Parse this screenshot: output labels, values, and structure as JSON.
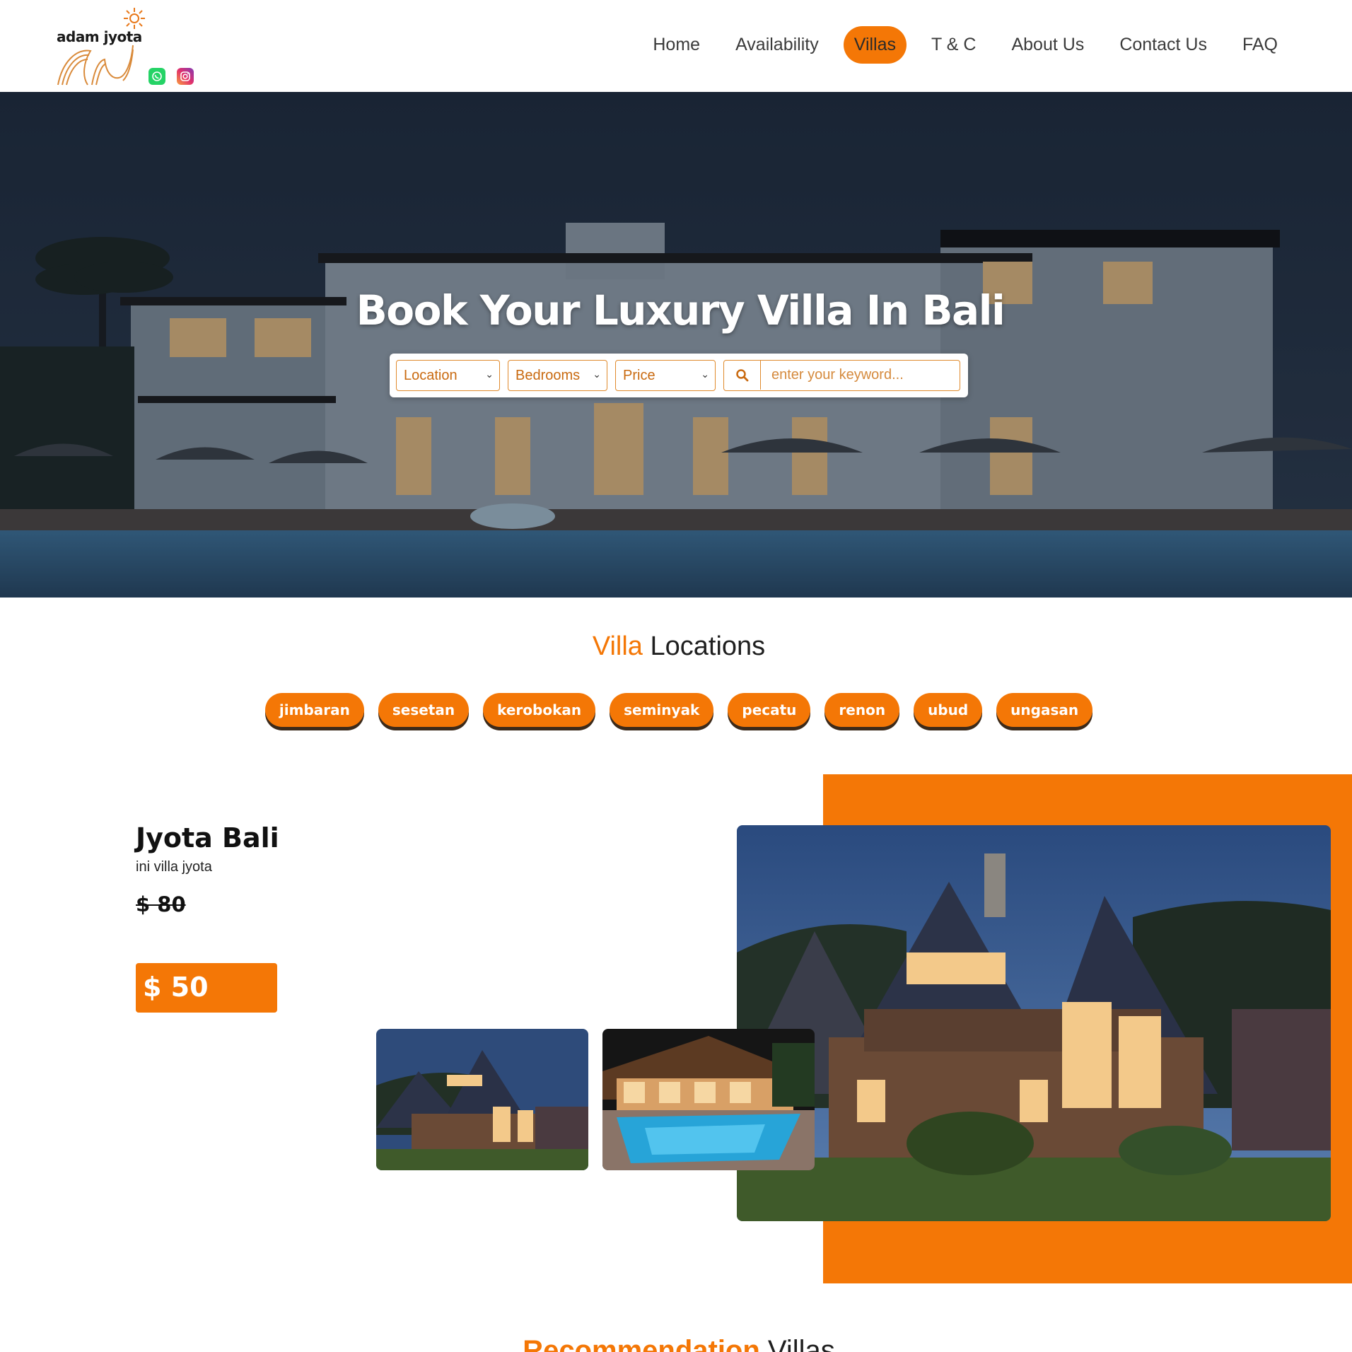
{
  "brand": {
    "name": "adam jyota",
    "accent": "#f47706"
  },
  "nav": {
    "items": [
      "Home",
      "Availability",
      "Villas",
      "T & C",
      "About Us",
      "Contact Us",
      "FAQ"
    ],
    "active": "Villas"
  },
  "social": {
    "icons": [
      "whatsapp-icon",
      "instagram-icon"
    ]
  },
  "hero": {
    "title": "Book Your Luxury Villa In Bali",
    "filters": {
      "location": "Location",
      "bedrooms": "Bedrooms",
      "price": "Price"
    },
    "search_placeholder": "enter your keyword..."
  },
  "locations": {
    "title_accent": "Villa",
    "title_rest": "Locations",
    "items": [
      "jimbaran",
      "sesetan",
      "kerobokan",
      "seminyak",
      "pecatu",
      "renon",
      "ubud",
      "ungasan"
    ]
  },
  "featured": {
    "name": "Jyota Bali",
    "description": "ini villa jyota",
    "old_price": "$ 80",
    "price": "$ 50"
  },
  "recommendation": {
    "title_accent": "Recommendation",
    "title_rest": "Villas"
  }
}
